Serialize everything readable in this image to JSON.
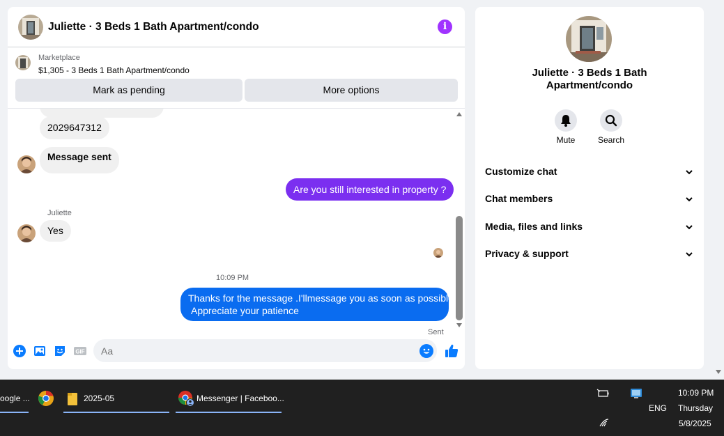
{
  "chat": {
    "title": "Juliette · 3 Beds 1 Bath Apartment/condo",
    "marketplace": {
      "label": "Marketplace",
      "detail": "$1,305 - 3 Beds 1 Bath Apartment/condo",
      "mark_pending": "Mark as pending",
      "more_options": "More options"
    },
    "messages": {
      "phone": "2029647312",
      "message_sent": "Message sent",
      "still_interested": "Are you still interested in property ?",
      "sender_name": "Juliette",
      "yes": "Yes",
      "time": "10:09 PM",
      "auto_reply_line1": "Thanks for the message .I'llmessage you as soon as possible.",
      "auto_reply_line2": "Appreciate your patience",
      "status": "Sent"
    },
    "composer": {
      "placeholder": "Aa"
    },
    "colors": {
      "outgoing_purple": "#7b2ff0",
      "outgoing_blue": "#0a6cf0",
      "incoming": "#f0f0f0",
      "accent": "#0a7cff"
    }
  },
  "info_panel": {
    "name_line1": "Juliette · 3 Beds 1 Bath",
    "name_line2": "Apartment/condo",
    "actions": {
      "mute": "Mute",
      "search": "Search"
    },
    "sections": {
      "customize": "Customize chat",
      "members": "Chat members",
      "media": "Media, files and links",
      "privacy": "Privacy & support"
    }
  },
  "taskbar": {
    "chrome_item": "oogle ...",
    "folder_item": "2025-05",
    "messenger_item": "Messenger | Faceboo...",
    "clock_time": "10:09 PM",
    "language": "ENG",
    "day": "Thursday",
    "date": "5/8/2025"
  }
}
